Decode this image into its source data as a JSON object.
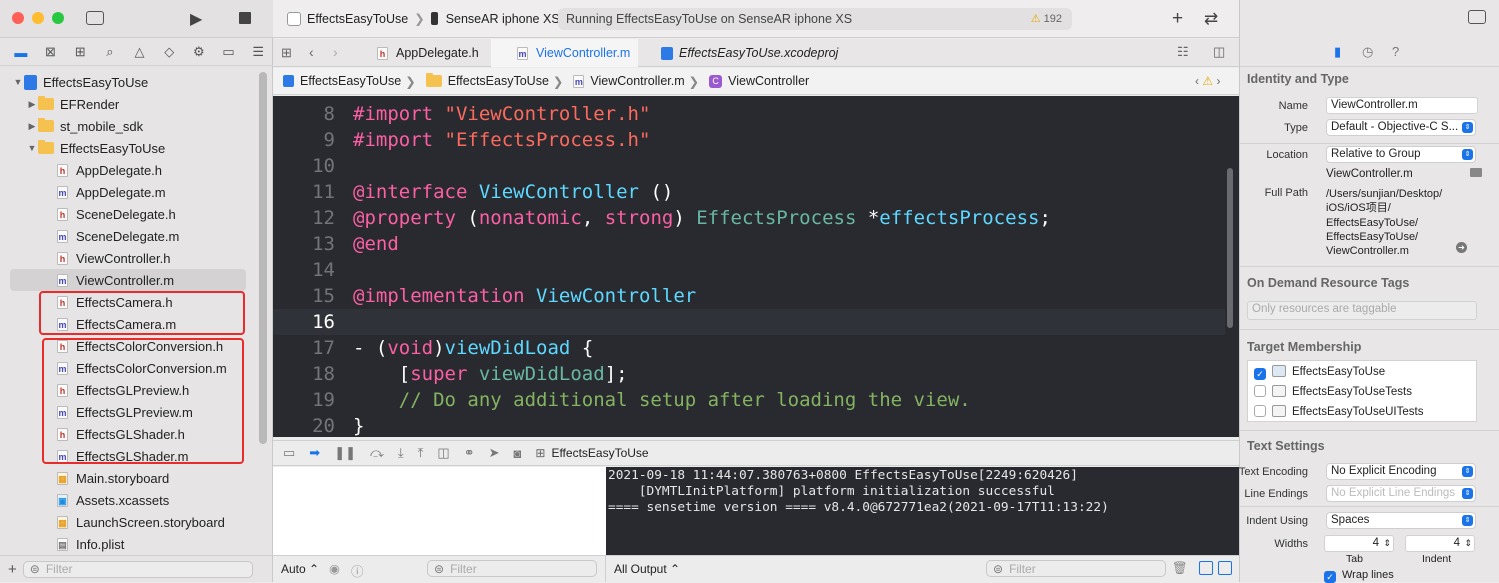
{
  "toolbar": {
    "scheme": "EffectsEasyToUse",
    "device": "SenseAR iphone XS",
    "status": "Running EffectsEasyToUse on SenseAR iphone XS",
    "warnings": "192"
  },
  "tabs": [
    {
      "label": "AppDelegate.h",
      "icon": "h"
    },
    {
      "label": "ViewController.m",
      "icon": "m"
    },
    {
      "label": "EffectsEasyToUse.xcodeproj",
      "icon": "project"
    }
  ],
  "jumpbar": [
    "EffectsEasyToUse",
    "EffectsEasyToUse",
    "ViewController.m",
    "ViewController"
  ],
  "navigator": {
    "rows": [
      {
        "label": "EffectsEasyToUse",
        "kind": "project"
      },
      {
        "label": "EFRender",
        "kind": "folder"
      },
      {
        "label": "st_mobile_sdk",
        "kind": "folder"
      },
      {
        "label": "EffectsEasyToUse",
        "kind": "folder"
      },
      {
        "label": "AppDelegate.h",
        "kind": "h"
      },
      {
        "label": "AppDelegate.m",
        "kind": "m"
      },
      {
        "label": "SceneDelegate.h",
        "kind": "h"
      },
      {
        "label": "SceneDelegate.m",
        "kind": "m"
      },
      {
        "label": "ViewController.h",
        "kind": "h"
      },
      {
        "label": "ViewController.m",
        "kind": "m"
      },
      {
        "label": "EffectsCamera.h",
        "kind": "h"
      },
      {
        "label": "EffectsCamera.m",
        "kind": "m"
      },
      {
        "label": "EffectsColorConversion.h",
        "kind": "h"
      },
      {
        "label": "EffectsColorConversion.m",
        "kind": "m"
      },
      {
        "label": "EffectsGLPreview.h",
        "kind": "h"
      },
      {
        "label": "EffectsGLPreview.m",
        "kind": "m"
      },
      {
        "label": "EffectsGLShader.h",
        "kind": "h"
      },
      {
        "label": "EffectsGLShader.m",
        "kind": "m"
      },
      {
        "label": "Main.storyboard",
        "kind": "storyboard"
      },
      {
        "label": "Assets.xcassets",
        "kind": "assets"
      },
      {
        "label": "LaunchScreen.storyboard",
        "kind": "storyboard"
      },
      {
        "label": "Info.plist",
        "kind": "plist"
      }
    ],
    "filter_placeholder": "Filter"
  },
  "editor": {
    "lines": [
      {
        "n": "8",
        "code": "#import \"ViewController.h\""
      },
      {
        "n": "9",
        "code": "#import \"EffectsProcess.h\""
      },
      {
        "n": "10",
        "code": ""
      },
      {
        "n": "11",
        "code": "@interface ViewController ()"
      },
      {
        "n": "12",
        "code": "@property (nonatomic, strong) EffectsProcess *effectsProcess;"
      },
      {
        "n": "13",
        "code": "@end"
      },
      {
        "n": "14",
        "code": ""
      },
      {
        "n": "15",
        "code": "@implementation ViewController"
      },
      {
        "n": "16",
        "code": ""
      },
      {
        "n": "17",
        "code": "- (void)viewDidLoad {"
      },
      {
        "n": "18",
        "code": "    [super viewDidLoad];"
      },
      {
        "n": "19",
        "code": "    // Do any additional setup after loading the view."
      },
      {
        "n": "20",
        "code": "}"
      }
    ]
  },
  "debug": {
    "target": "EffectsEasyToUse",
    "auto_label": "Auto",
    "filter_placeholder": "Filter",
    "output_label": "All Output",
    "console_lines": [
      "2021-09-18 11:44:07.380763+0800 EffectsEasyToUse[2249:620426]",
      "    [DYMTLInitPlatform] platform initialization successful",
      "==== sensetime version ==== v8.4.0@672771ea2(2021-09-17T11:13:22)"
    ]
  },
  "inspector": {
    "identity_title": "Identity and Type",
    "name_label": "Name",
    "name_value": "ViewController.m",
    "type_label": "Type",
    "type_value": "Default - Objective-C S...",
    "location_label": "Location",
    "location_value": "Relative to Group",
    "location_file": "ViewController.m",
    "fullpath_label": "Full Path",
    "fullpath_lines": [
      "/Users/sunjian/Desktop/",
      "iOS/iOS项目/",
      "EffectsEasyToUse/",
      "EffectsEasyToUse/",
      "ViewController.m"
    ],
    "ondemand_title": "On Demand Resource Tags",
    "ondemand_placeholder": "Only resources are taggable",
    "target_title": "Target Membership",
    "targets": [
      {
        "label": "EffectsEasyToUse",
        "checked": true
      },
      {
        "label": "EffectsEasyToUseTests",
        "checked": false
      },
      {
        "label": "EffectsEasyToUseUITests",
        "checked": false
      }
    ],
    "text_title": "Text Settings",
    "encoding_label": "Text Encoding",
    "encoding_value": "No Explicit Encoding",
    "endings_label": "Line Endings",
    "endings_value": "No Explicit Line Endings",
    "indent_label": "Indent Using",
    "indent_value": "Spaces",
    "widths_label": "Widths",
    "tab_width": "4",
    "indent_width": "4",
    "tab_label": "Tab",
    "indent_sub_label": "Indent",
    "wrap_label": "Wrap lines"
  },
  "colors": {
    "accent": "#1a73e8",
    "highlight_box": "#e82c2c",
    "editor_bg": "#292a30"
  }
}
